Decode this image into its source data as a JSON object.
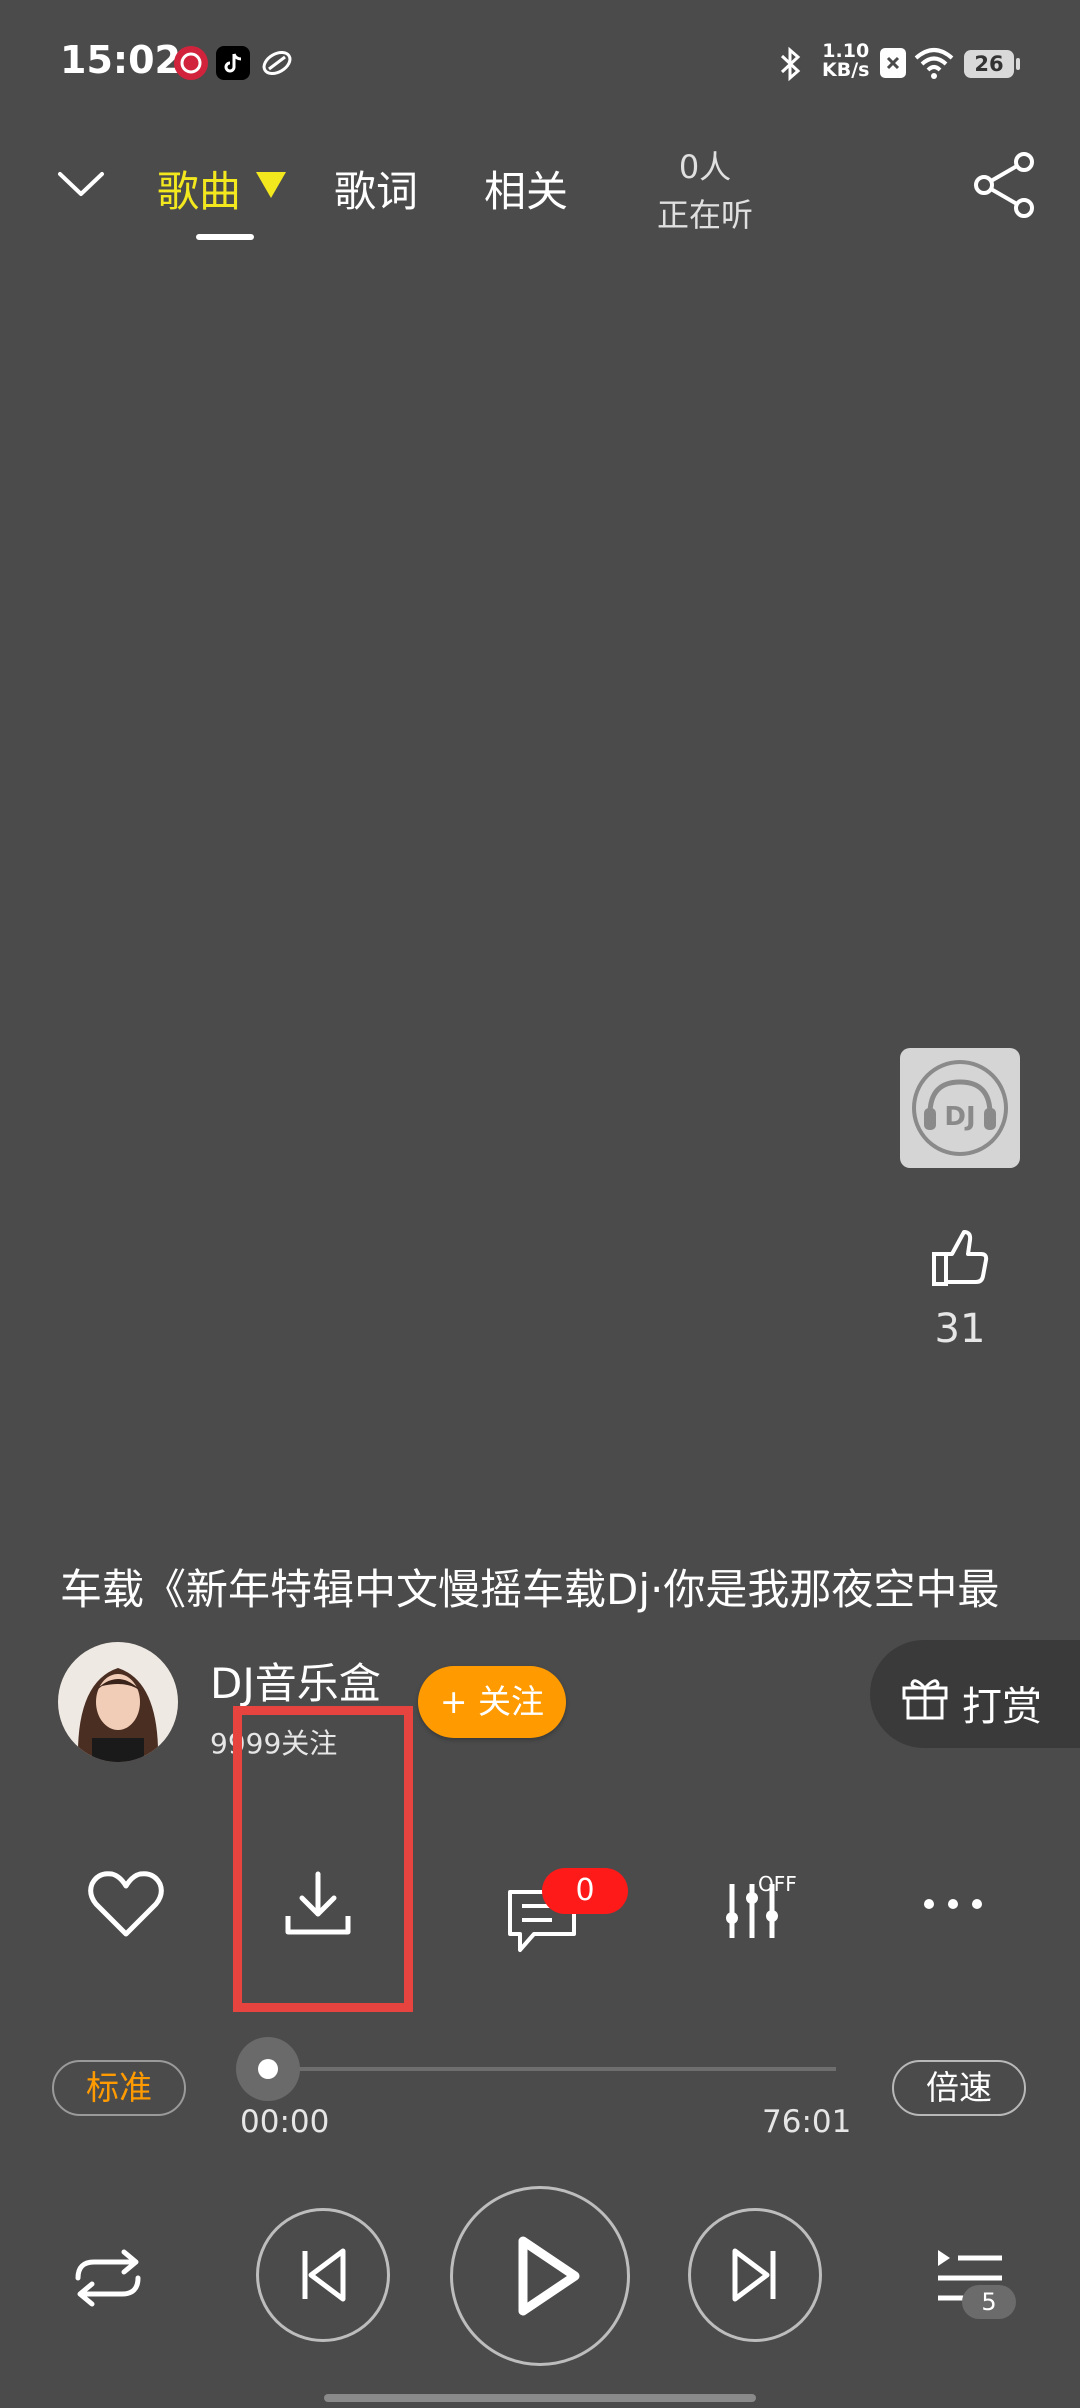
{
  "status_bar": {
    "time": "15:02",
    "net_speed_value": "1.10",
    "net_speed_unit": "KB/s",
    "battery": "26",
    "app_icons": [
      "dj-app-icon",
      "tiktok-icon",
      "link-app-icon"
    ]
  },
  "top_nav": {
    "tabs": [
      {
        "label": "歌曲",
        "active": true
      },
      {
        "label": "歌词",
        "active": false
      },
      {
        "label": "相关",
        "active": false
      }
    ],
    "listeners_count": "0人",
    "listeners_label": "正在听"
  },
  "side": {
    "like_count": "31"
  },
  "song": {
    "title": "车载《新年特辑中文慢摇车载Dj·你是我那夜空中最"
  },
  "artist": {
    "name": "DJ音乐盒",
    "followers": "9999关注",
    "follow_label": "+ 关注",
    "reward_label": "打赏"
  },
  "actions": {
    "comment_count": "0",
    "eq_state": "OFF"
  },
  "progress": {
    "quality_label": "标准",
    "speed_label": "倍速",
    "current_time": "00:00",
    "total_time": "76:01",
    "fraction": 0
  },
  "playback": {
    "playlist_count": "5"
  },
  "colors": {
    "background": "#4b4b4b",
    "active_tab": "#f3e81e",
    "accent_orange": "#ff9b00",
    "badge_red": "#ff1a1a",
    "highlight_box": "#e8443f"
  }
}
